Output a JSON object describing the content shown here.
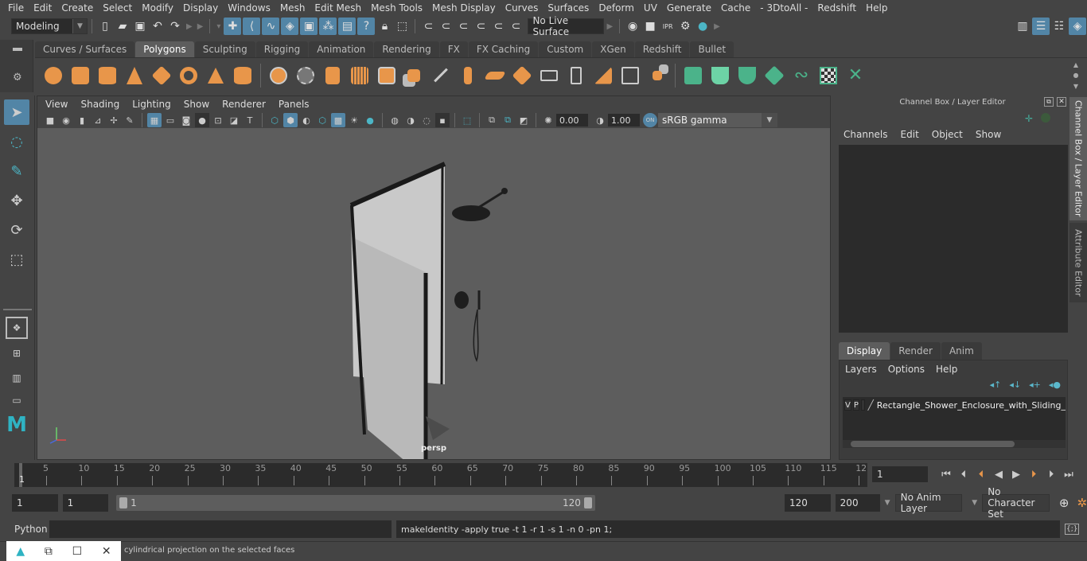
{
  "menubar": {
    "items": [
      "File",
      "Edit",
      "Create",
      "Select",
      "Modify",
      "Display",
      "Windows",
      "Mesh",
      "Edit Mesh",
      "Mesh Tools",
      "Mesh Display",
      "Curves",
      "Surfaces",
      "Deform",
      "UV",
      "Generate",
      "Cache",
      "- 3DtoAll -",
      "Redshift",
      "Help"
    ]
  },
  "statusline": {
    "workspace": "Modeling",
    "live_surface": "No Live Surface"
  },
  "shelf": {
    "tabs": [
      "Curves / Surfaces",
      "Polygons",
      "Sculpting",
      "Rigging",
      "Animation",
      "Rendering",
      "FX",
      "FX Caching",
      "Custom",
      "XGen",
      "Redshift",
      "Bullet"
    ],
    "active_tab": "Polygons"
  },
  "viewport": {
    "menu": [
      "View",
      "Shading",
      "Lighting",
      "Show",
      "Renderer",
      "Panels"
    ],
    "exposure": "0.00",
    "gamma": "1.00",
    "color_space": "sRGB gamma",
    "camera": "persp"
  },
  "right_panel": {
    "title": "Channel Box / Layer Editor",
    "channel_menu": [
      "Channels",
      "Edit",
      "Object",
      "Show"
    ],
    "layer_tabs": [
      "Display",
      "Render",
      "Anim"
    ],
    "active_layer_tab": "Display",
    "layer_menu": [
      "Layers",
      "Options",
      "Help"
    ],
    "layers": [
      {
        "v": "V",
        "p": "P",
        "name": "Rectangle_Shower_Enclosure_with_Sliding_"
      }
    ],
    "side_tabs": [
      "Channel Box / Layer Editor",
      "Attribute Editor"
    ]
  },
  "timeline": {
    "ticks": [
      "5",
      "10",
      "15",
      "20",
      "25",
      "30",
      "35",
      "40",
      "45",
      "50",
      "55",
      "60",
      "65",
      "70",
      "75",
      "80",
      "85",
      "90",
      "95",
      "100",
      "105",
      "110",
      "115",
      "12"
    ],
    "start_marker": "1",
    "current_frame": "1"
  },
  "range": {
    "start": "1",
    "playback_start": "1",
    "slider_min": "1",
    "slider_max": "120",
    "playback_end": "120",
    "end": "200",
    "anim_layer": "No Anim Layer",
    "character_set": "No Character Set"
  },
  "command": {
    "language": "Python",
    "input": "",
    "result": "makeIdentity -apply true -t 1 -r 1 -s 1 -n 0 -pn 1;"
  },
  "help_line": "cylindrical projection on the selected faces"
}
